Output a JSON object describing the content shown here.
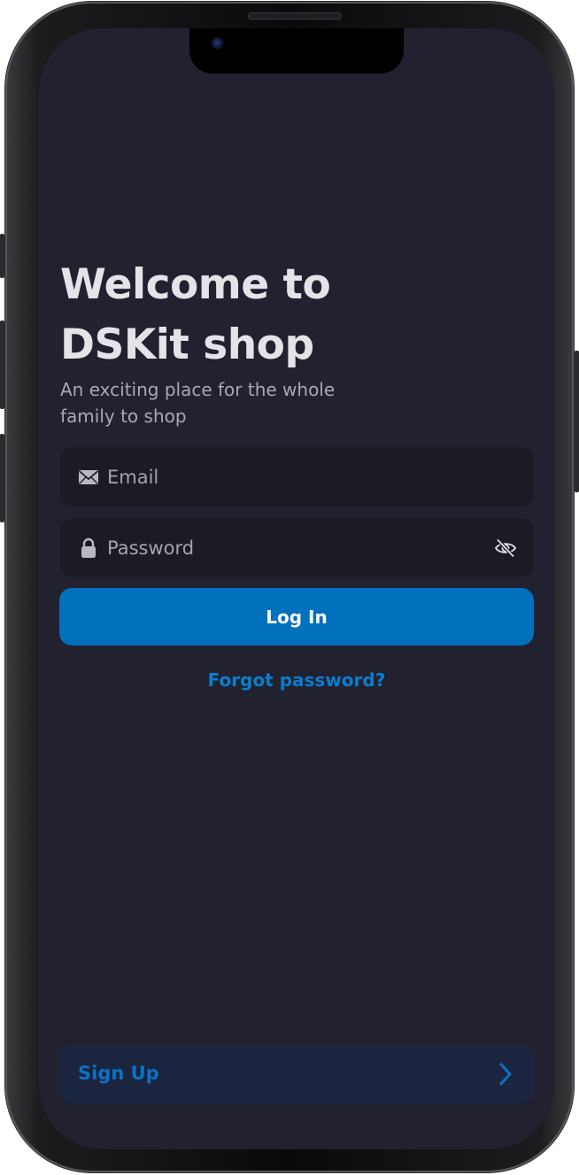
{
  "header": {
    "title_line1": "Welcome to",
    "title_line2": "DSKit shop",
    "subtitle": "An exciting place for the whole family to shop"
  },
  "form": {
    "email_placeholder": "Email",
    "email_value": "",
    "password_placeholder": "Password",
    "password_value": "",
    "email_icon": "envelope-icon",
    "password_icon": "lock-icon",
    "visibility_icon": "eye-slash-icon"
  },
  "actions": {
    "login_label": "Log In",
    "forgot_label": "Forgot password?",
    "signup_label": "Sign Up",
    "signup_icon": "chevron-right-icon"
  },
  "colors": {
    "background": "#212130",
    "field_background": "#1b1b26",
    "primary": "#0170bd",
    "link": "#0a7dcf",
    "signup_background": "#1b2540"
  }
}
